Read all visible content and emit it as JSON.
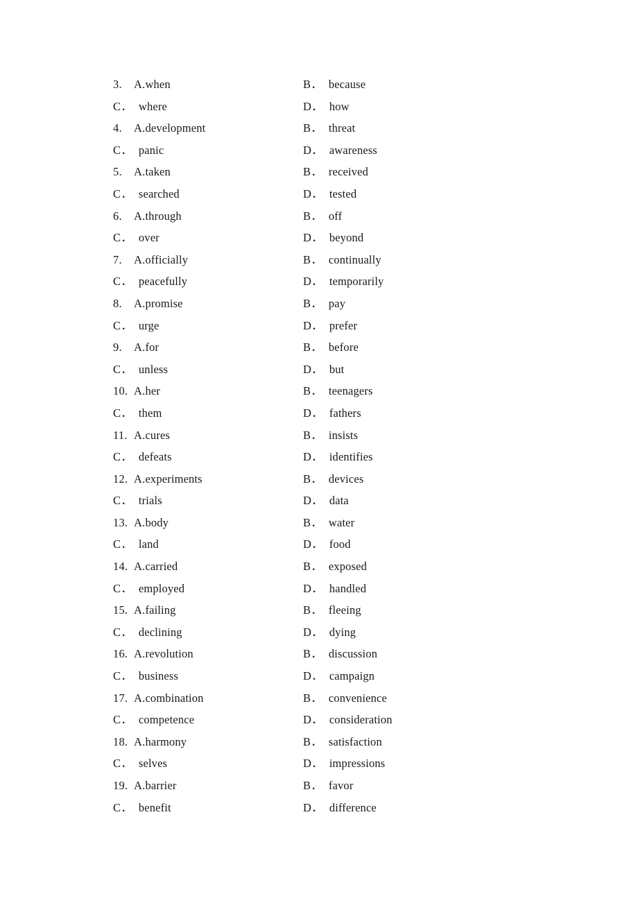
{
  "document": {
    "type": "multiple-choice-answer-options",
    "background_color": "#ffffff",
    "text_color": "#1a1a1a"
  },
  "questions": [
    {
      "number": "3.",
      "A": {
        "label": "A.",
        "text": "when"
      },
      "B": {
        "label": "B．",
        "text": "because"
      },
      "C": {
        "label": "C．",
        "text": "where"
      },
      "D": {
        "label": "D．",
        "text": "how"
      }
    },
    {
      "number": "4.",
      "A": {
        "label": "A.",
        "text": "development"
      },
      "B": {
        "label": "B．",
        "text": "threat"
      },
      "C": {
        "label": "C．",
        "text": "panic"
      },
      "D": {
        "label": "D．",
        "text": "awareness"
      }
    },
    {
      "number": "5.",
      "A": {
        "label": "A.",
        "text": "taken"
      },
      "B": {
        "label": "B．",
        "text": "received"
      },
      "C": {
        "label": "C．",
        "text": "searched"
      },
      "D": {
        "label": "D．",
        "text": "tested"
      }
    },
    {
      "number": "6.",
      "A": {
        "label": "A.",
        "text": "through"
      },
      "B": {
        "label": "B．",
        "text": "off"
      },
      "C": {
        "label": "C．",
        "text": "over"
      },
      "D": {
        "label": "D．",
        "text": "beyond"
      }
    },
    {
      "number": "7.",
      "A": {
        "label": "A.",
        "text": "officially"
      },
      "B": {
        "label": "B．",
        "text": "continually"
      },
      "C": {
        "label": "C．",
        "text": "peacefully"
      },
      "D": {
        "label": "D．",
        "text": "temporarily"
      }
    },
    {
      "number": "8.",
      "A": {
        "label": "A.",
        "text": "promise"
      },
      "B": {
        "label": "B．",
        "text": "pay"
      },
      "C": {
        "label": "C．",
        "text": "urge"
      },
      "D": {
        "label": "D．",
        "text": "prefer"
      }
    },
    {
      "number": "9.",
      "A": {
        "label": "A.",
        "text": "for"
      },
      "B": {
        "label": "B．",
        "text": "before"
      },
      "C": {
        "label": "C．",
        "text": "unless"
      },
      "D": {
        "label": "D．",
        "text": "but"
      }
    },
    {
      "number": "10.",
      "A": {
        "label": "A.",
        "text": "her"
      },
      "B": {
        "label": "B．",
        "text": "teenagers"
      },
      "C": {
        "label": "C．",
        "text": "them"
      },
      "D": {
        "label": "D．",
        "text": "fathers"
      }
    },
    {
      "number": "11.",
      "A": {
        "label": "A.",
        "text": "cures"
      },
      "B": {
        "label": "B．",
        "text": "insists"
      },
      "C": {
        "label": "C．",
        "text": "defeats"
      },
      "D": {
        "label": "D．",
        "text": "identifies"
      }
    },
    {
      "number": "12.",
      "A": {
        "label": "A.",
        "text": "experiments"
      },
      "B": {
        "label": "B．",
        "text": "devices"
      },
      "C": {
        "label": "C．",
        "text": "trials"
      },
      "D": {
        "label": "D．",
        "text": "data"
      }
    },
    {
      "number": "13.",
      "A": {
        "label": "A.",
        "text": "body"
      },
      "B": {
        "label": "B．",
        "text": "water"
      },
      "C": {
        "label": "C．",
        "text": "land"
      },
      "D": {
        "label": "D．",
        "text": "food"
      }
    },
    {
      "number": "14.",
      "A": {
        "label": "A.",
        "text": "carried"
      },
      "B": {
        "label": "B．",
        "text": "exposed"
      },
      "C": {
        "label": "C．",
        "text": "employed"
      },
      "D": {
        "label": "D．",
        "text": "handled"
      }
    },
    {
      "number": "15.",
      "A": {
        "label": "A.",
        "text": "failing"
      },
      "B": {
        "label": "B．",
        "text": "fleeing"
      },
      "C": {
        "label": "C．",
        "text": "declining"
      },
      "D": {
        "label": "D．",
        "text": "dying"
      }
    },
    {
      "number": "16.",
      "A": {
        "label": "A.",
        "text": "revolution"
      },
      "B": {
        "label": "B．",
        "text": "discussion"
      },
      "C": {
        "label": "C．",
        "text": "business"
      },
      "D": {
        "label": "D．",
        "text": "campaign"
      }
    },
    {
      "number": "17.",
      "A": {
        "label": "A.",
        "text": "combination"
      },
      "B": {
        "label": "B．",
        "text": "convenience"
      },
      "C": {
        "label": "C．",
        "text": "competence"
      },
      "D": {
        "label": "D．",
        "text": "consideration"
      }
    },
    {
      "number": "18.",
      "A": {
        "label": "A.",
        "text": "harmony"
      },
      "B": {
        "label": "B．",
        "text": "satisfaction"
      },
      "C": {
        "label": "C．",
        "text": "selves"
      },
      "D": {
        "label": "D．",
        "text": "impressions"
      }
    },
    {
      "number": "19.",
      "A": {
        "label": "A.",
        "text": "barrier"
      },
      "B": {
        "label": "B．",
        "text": "favor"
      },
      "C": {
        "label": "C．",
        "text": "benefit"
      },
      "D": {
        "label": "D．",
        "text": "difference"
      }
    }
  ]
}
